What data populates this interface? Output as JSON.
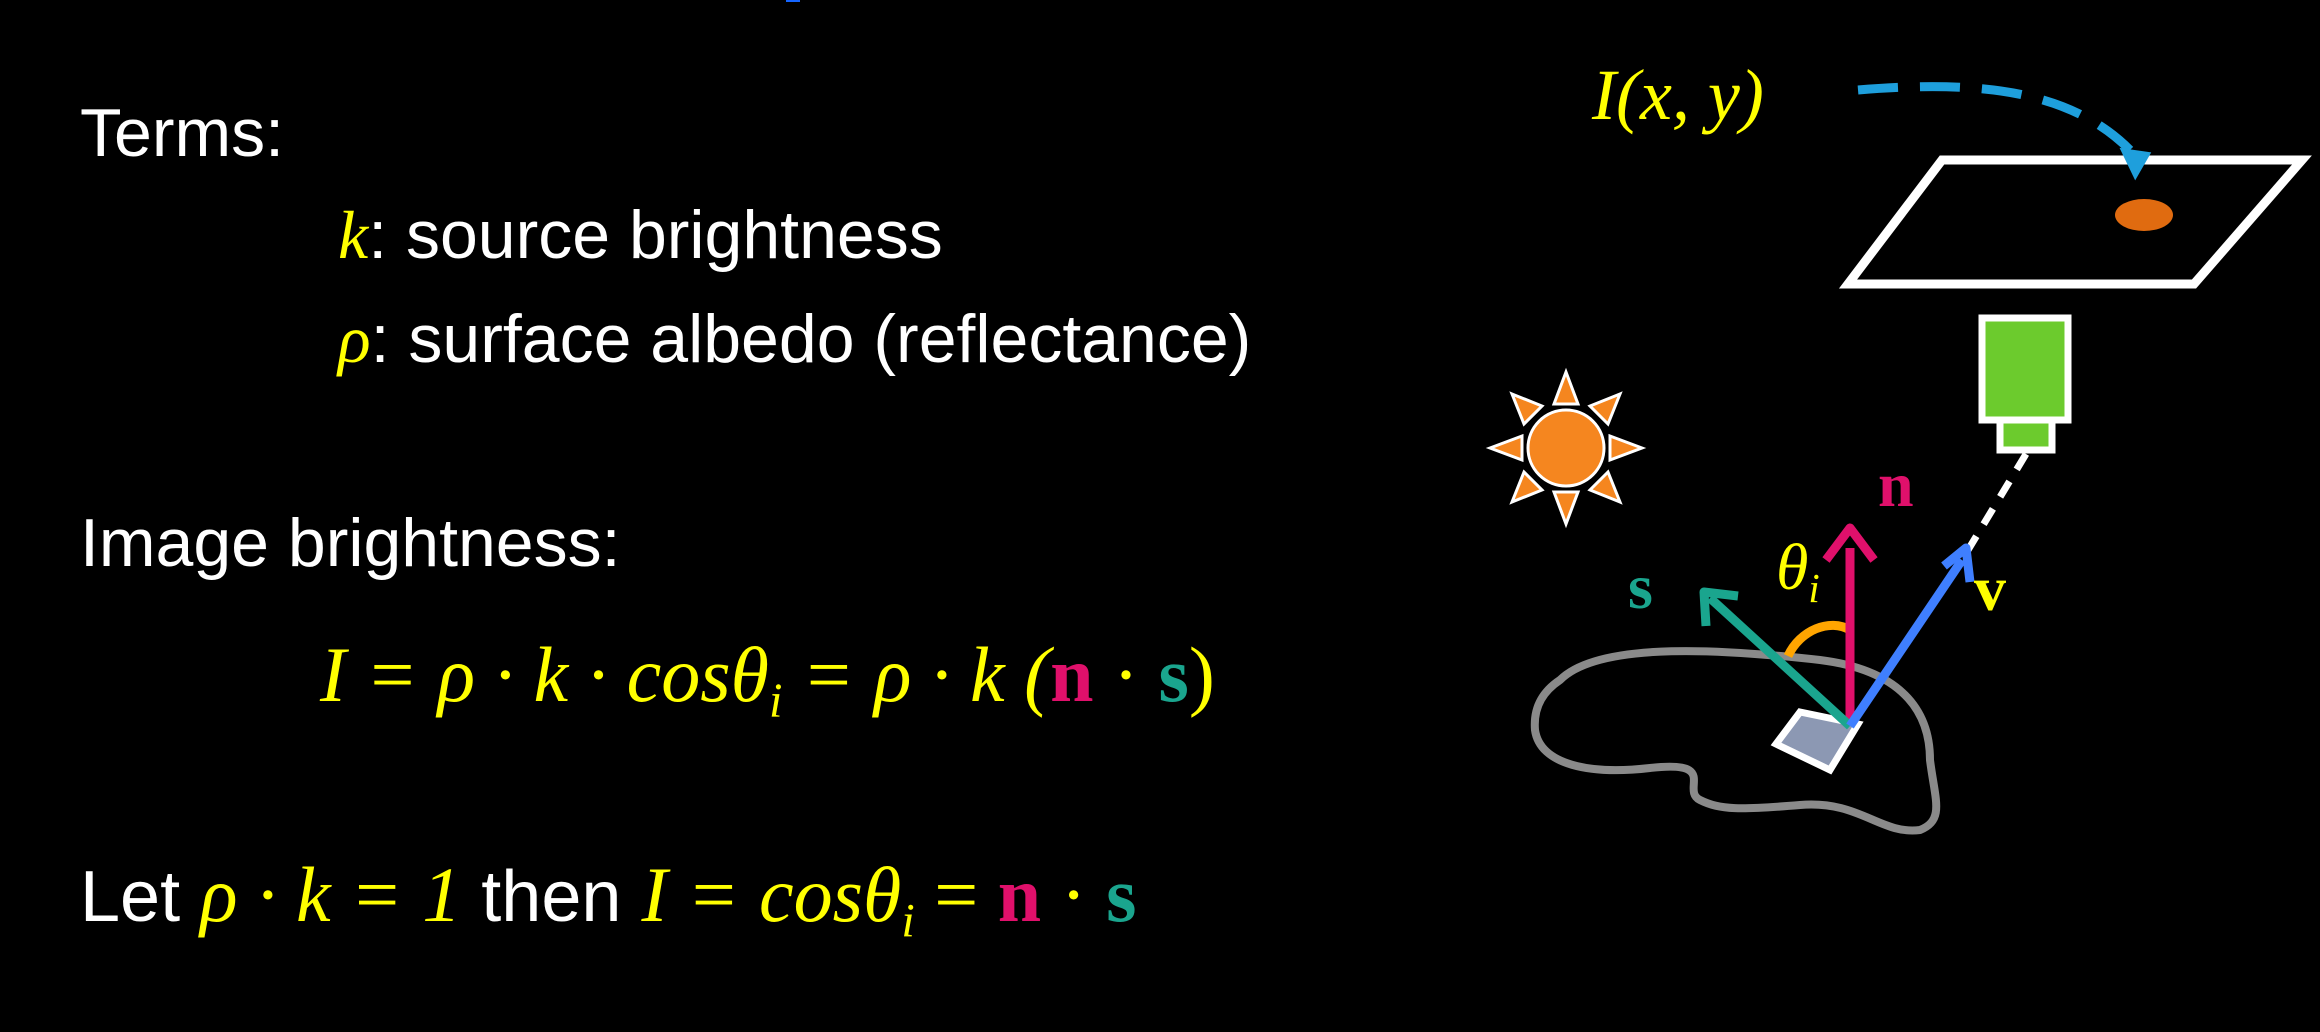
{
  "terms": {
    "heading": "Terms:",
    "k_symbol": "k",
    "k_text": ": source brightness",
    "rho_symbol": "ρ",
    "rho_text": ": surface albedo (reflectance)"
  },
  "image_brightness": {
    "heading": "Image brightness:",
    "equation": {
      "I": "I",
      "eq1": " = ρ · k · cosθ",
      "sub1": "i",
      "eq2": " = ρ · k (",
      "n": "n",
      "dot": " · ",
      "s": "s",
      "close": ")"
    }
  },
  "let_line": {
    "let": "Let ",
    "cond": "ρ · k = 1",
    "then": " then ",
    "I": "I",
    "eq": " = cosθ",
    "sub": "i",
    "eq2": " = ",
    "n": "n",
    "dot": " · ",
    "s": "s"
  },
  "diagram": {
    "image_label": "I(x, y)",
    "normal_label": "n",
    "source_label": "s",
    "view_label": "v",
    "angle_label": "θ",
    "angle_sub": "i"
  },
  "colors": {
    "background": "#000000",
    "math_yellow": "#ffff00",
    "normal_pink": "#e0106b",
    "source_teal": "#1aa58e",
    "view_blue": "#3f7fff",
    "sun_orange": "#f5861f",
    "camera_green": "#6ccb2d",
    "dashed_blue": "#1e9fdc",
    "angle_orange": "#ffa500"
  }
}
